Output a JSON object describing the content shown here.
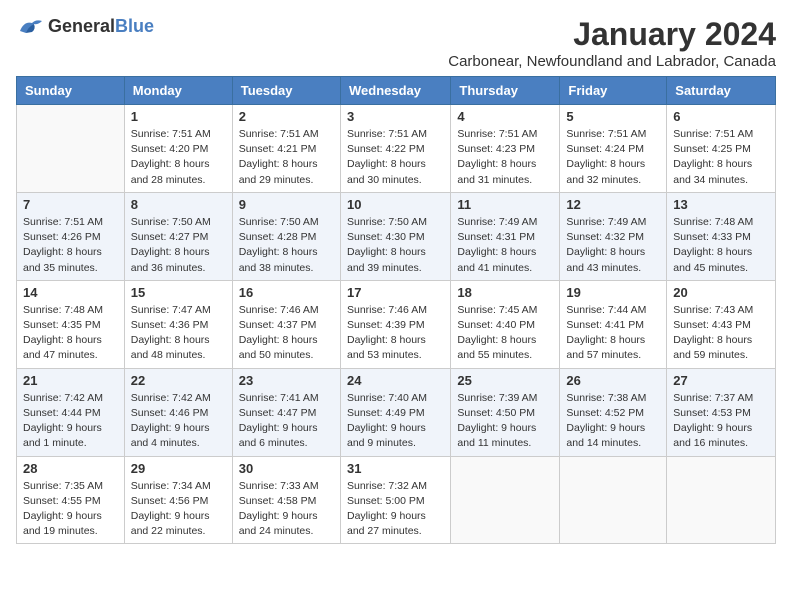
{
  "logo": {
    "general": "General",
    "blue": "Blue"
  },
  "title": "January 2024",
  "subtitle": "Carbonear, Newfoundland and Labrador, Canada",
  "days_header": [
    "Sunday",
    "Monday",
    "Tuesday",
    "Wednesday",
    "Thursday",
    "Friday",
    "Saturday"
  ],
  "weeks": [
    [
      {
        "day": "",
        "sunrise": "",
        "sunset": "",
        "daylight": ""
      },
      {
        "day": "1",
        "sunrise": "Sunrise: 7:51 AM",
        "sunset": "Sunset: 4:20 PM",
        "daylight": "Daylight: 8 hours and 28 minutes."
      },
      {
        "day": "2",
        "sunrise": "Sunrise: 7:51 AM",
        "sunset": "Sunset: 4:21 PM",
        "daylight": "Daylight: 8 hours and 29 minutes."
      },
      {
        "day": "3",
        "sunrise": "Sunrise: 7:51 AM",
        "sunset": "Sunset: 4:22 PM",
        "daylight": "Daylight: 8 hours and 30 minutes."
      },
      {
        "day": "4",
        "sunrise": "Sunrise: 7:51 AM",
        "sunset": "Sunset: 4:23 PM",
        "daylight": "Daylight: 8 hours and 31 minutes."
      },
      {
        "day": "5",
        "sunrise": "Sunrise: 7:51 AM",
        "sunset": "Sunset: 4:24 PM",
        "daylight": "Daylight: 8 hours and 32 minutes."
      },
      {
        "day": "6",
        "sunrise": "Sunrise: 7:51 AM",
        "sunset": "Sunset: 4:25 PM",
        "daylight": "Daylight: 8 hours and 34 minutes."
      }
    ],
    [
      {
        "day": "7",
        "sunrise": "Sunrise: 7:51 AM",
        "sunset": "Sunset: 4:26 PM",
        "daylight": "Daylight: 8 hours and 35 minutes."
      },
      {
        "day": "8",
        "sunrise": "Sunrise: 7:50 AM",
        "sunset": "Sunset: 4:27 PM",
        "daylight": "Daylight: 8 hours and 36 minutes."
      },
      {
        "day": "9",
        "sunrise": "Sunrise: 7:50 AM",
        "sunset": "Sunset: 4:28 PM",
        "daylight": "Daylight: 8 hours and 38 minutes."
      },
      {
        "day": "10",
        "sunrise": "Sunrise: 7:50 AM",
        "sunset": "Sunset: 4:30 PM",
        "daylight": "Daylight: 8 hours and 39 minutes."
      },
      {
        "day": "11",
        "sunrise": "Sunrise: 7:49 AM",
        "sunset": "Sunset: 4:31 PM",
        "daylight": "Daylight: 8 hours and 41 minutes."
      },
      {
        "day": "12",
        "sunrise": "Sunrise: 7:49 AM",
        "sunset": "Sunset: 4:32 PM",
        "daylight": "Daylight: 8 hours and 43 minutes."
      },
      {
        "day": "13",
        "sunrise": "Sunrise: 7:48 AM",
        "sunset": "Sunset: 4:33 PM",
        "daylight": "Daylight: 8 hours and 45 minutes."
      }
    ],
    [
      {
        "day": "14",
        "sunrise": "Sunrise: 7:48 AM",
        "sunset": "Sunset: 4:35 PM",
        "daylight": "Daylight: 8 hours and 47 minutes."
      },
      {
        "day": "15",
        "sunrise": "Sunrise: 7:47 AM",
        "sunset": "Sunset: 4:36 PM",
        "daylight": "Daylight: 8 hours and 48 minutes."
      },
      {
        "day": "16",
        "sunrise": "Sunrise: 7:46 AM",
        "sunset": "Sunset: 4:37 PM",
        "daylight": "Daylight: 8 hours and 50 minutes."
      },
      {
        "day": "17",
        "sunrise": "Sunrise: 7:46 AM",
        "sunset": "Sunset: 4:39 PM",
        "daylight": "Daylight: 8 hours and 53 minutes."
      },
      {
        "day": "18",
        "sunrise": "Sunrise: 7:45 AM",
        "sunset": "Sunset: 4:40 PM",
        "daylight": "Daylight: 8 hours and 55 minutes."
      },
      {
        "day": "19",
        "sunrise": "Sunrise: 7:44 AM",
        "sunset": "Sunset: 4:41 PM",
        "daylight": "Daylight: 8 hours and 57 minutes."
      },
      {
        "day": "20",
        "sunrise": "Sunrise: 7:43 AM",
        "sunset": "Sunset: 4:43 PM",
        "daylight": "Daylight: 8 hours and 59 minutes."
      }
    ],
    [
      {
        "day": "21",
        "sunrise": "Sunrise: 7:42 AM",
        "sunset": "Sunset: 4:44 PM",
        "daylight": "Daylight: 9 hours and 1 minute."
      },
      {
        "day": "22",
        "sunrise": "Sunrise: 7:42 AM",
        "sunset": "Sunset: 4:46 PM",
        "daylight": "Daylight: 9 hours and 4 minutes."
      },
      {
        "day": "23",
        "sunrise": "Sunrise: 7:41 AM",
        "sunset": "Sunset: 4:47 PM",
        "daylight": "Daylight: 9 hours and 6 minutes."
      },
      {
        "day": "24",
        "sunrise": "Sunrise: 7:40 AM",
        "sunset": "Sunset: 4:49 PM",
        "daylight": "Daylight: 9 hours and 9 minutes."
      },
      {
        "day": "25",
        "sunrise": "Sunrise: 7:39 AM",
        "sunset": "Sunset: 4:50 PM",
        "daylight": "Daylight: 9 hours and 11 minutes."
      },
      {
        "day": "26",
        "sunrise": "Sunrise: 7:38 AM",
        "sunset": "Sunset: 4:52 PM",
        "daylight": "Daylight: 9 hours and 14 minutes."
      },
      {
        "day": "27",
        "sunrise": "Sunrise: 7:37 AM",
        "sunset": "Sunset: 4:53 PM",
        "daylight": "Daylight: 9 hours and 16 minutes."
      }
    ],
    [
      {
        "day": "28",
        "sunrise": "Sunrise: 7:35 AM",
        "sunset": "Sunset: 4:55 PM",
        "daylight": "Daylight: 9 hours and 19 minutes."
      },
      {
        "day": "29",
        "sunrise": "Sunrise: 7:34 AM",
        "sunset": "Sunset: 4:56 PM",
        "daylight": "Daylight: 9 hours and 22 minutes."
      },
      {
        "day": "30",
        "sunrise": "Sunrise: 7:33 AM",
        "sunset": "Sunset: 4:58 PM",
        "daylight": "Daylight: 9 hours and 24 minutes."
      },
      {
        "day": "31",
        "sunrise": "Sunrise: 7:32 AM",
        "sunset": "Sunset: 5:00 PM",
        "daylight": "Daylight: 9 hours and 27 minutes."
      },
      {
        "day": "",
        "sunrise": "",
        "sunset": "",
        "daylight": ""
      },
      {
        "day": "",
        "sunrise": "",
        "sunset": "",
        "daylight": ""
      },
      {
        "day": "",
        "sunrise": "",
        "sunset": "",
        "daylight": ""
      }
    ]
  ]
}
